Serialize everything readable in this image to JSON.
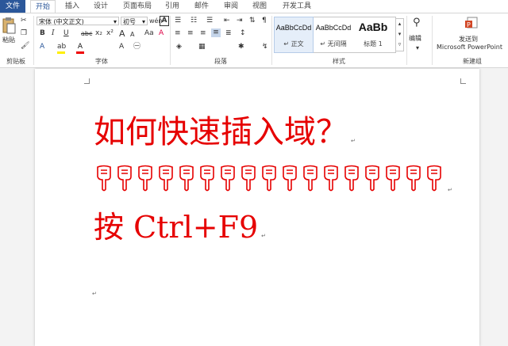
{
  "tabs": [
    "文件",
    "开始",
    "插入",
    "设计",
    "页面布局",
    "引用",
    "邮件",
    "审阅",
    "视图",
    "开发工具"
  ],
  "clipboard": {
    "paste": "粘贴",
    "group": "剪贴板"
  },
  "font": {
    "name": "宋体 (中文正文)",
    "size": "初号",
    "group": "字体",
    "buttons": {
      "bold": "B",
      "italic": "I",
      "underline": "U",
      "strike": "abc",
      "sub": "x₂",
      "sup": "x²",
      "grow": "A",
      "shrink": "A",
      "clear": "A",
      "phonetic": "wén",
      "border": "A",
      "case": "Aa"
    }
  },
  "paragraph": {
    "group": "段落"
  },
  "styles": {
    "group": "样式",
    "items": [
      {
        "preview": "AaBbCcDd",
        "name": "↵ 正文"
      },
      {
        "preview": "AaBbCcDd",
        "name": "↵ 无间隔"
      },
      {
        "preview": "AaBb",
        "name": "标题 1"
      }
    ]
  },
  "editing": {
    "label": "编辑"
  },
  "newgroup": {
    "send": "发送到",
    "app": "Microsoft PowerPoint",
    "group": "新建组"
  },
  "document": {
    "line1": "如何快速插入域？",
    "line2_count": 17,
    "line3": "按 Ctrl+F9",
    "para_mark": "↵"
  },
  "colors": {
    "accent": "#2b579a",
    "text": "#e60000"
  }
}
